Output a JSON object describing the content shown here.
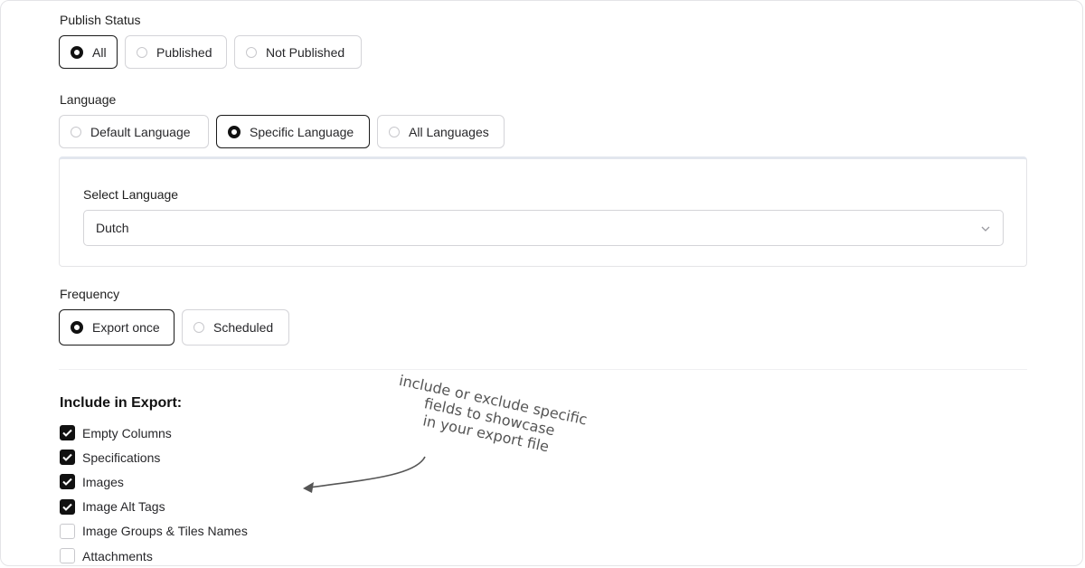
{
  "publish_status": {
    "label": "Publish Status",
    "options": [
      "All",
      "Published",
      "Not Published"
    ],
    "selected": "All"
  },
  "language": {
    "label": "Language",
    "options": [
      "Default Language",
      "Specific Language",
      "All Languages"
    ],
    "selected": "Specific Language",
    "select_label": "Select Language",
    "select_value": "Dutch"
  },
  "frequency": {
    "label": "Frequency",
    "options": [
      "Export once",
      "Scheduled"
    ],
    "selected": "Export once"
  },
  "include": {
    "title": "Include in Export:",
    "items": [
      {
        "label": "Empty Columns",
        "checked": true
      },
      {
        "label": "Specifications",
        "checked": true
      },
      {
        "label": "Images",
        "checked": true
      },
      {
        "label": "Image Alt Tags",
        "checked": true
      },
      {
        "label": "Image Groups & Tiles Names",
        "checked": false
      },
      {
        "label": "Attachments",
        "checked": false
      }
    ]
  },
  "annotation": {
    "line1": "include or exclude specific",
    "line2": "fields to showcase",
    "line3": "in your export file"
  },
  "colors": {
    "selected_border": "#1a1a1a",
    "check_fill": "#111111",
    "border": "#d4d4d8"
  }
}
